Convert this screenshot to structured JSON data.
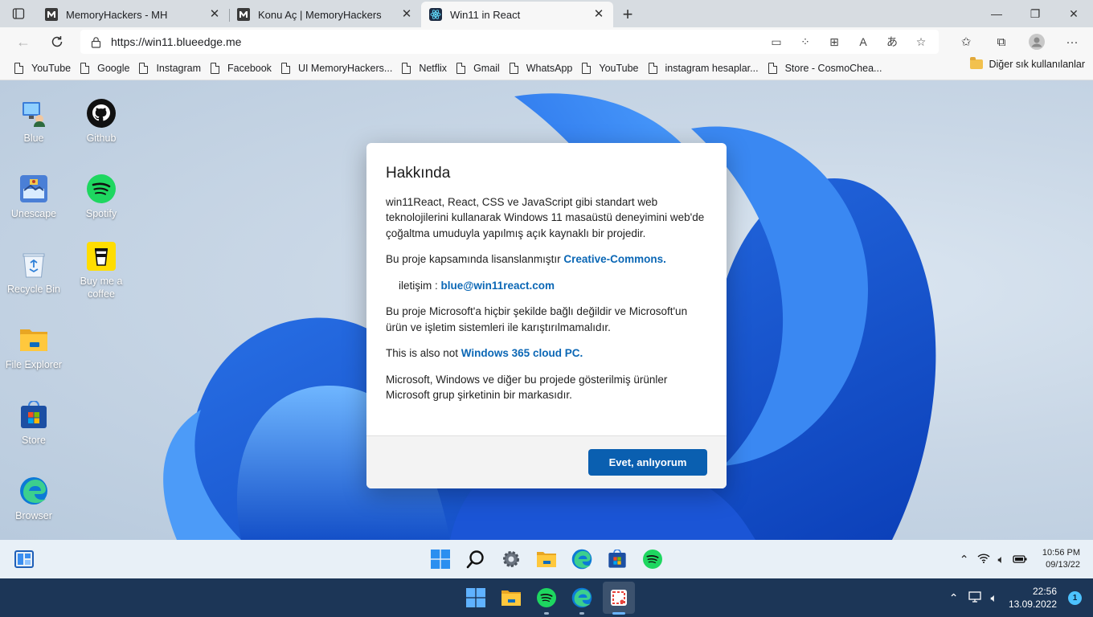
{
  "browser": {
    "tabs": [
      {
        "title": "MemoryHackers - MH",
        "icon": "memoryhackers-favicon",
        "active": false
      },
      {
        "title": "Konu Aç | MemoryHackers",
        "icon": "memoryhackers-favicon",
        "active": false
      },
      {
        "title": "Win11 in React",
        "icon": "react-favicon",
        "active": true
      }
    ],
    "url": "https://win11.blueedge.me",
    "bookmarks": [
      "YouTube",
      "Google",
      "Instagram",
      "Facebook",
      "UI MemoryHackers...",
      "Netflix",
      "Gmail",
      "WhatsApp",
      "YouTube",
      "instagram hesaplar...",
      "Store - CosmoChea..."
    ],
    "other_bookmarks": "Diğer sık kullanılanlar"
  },
  "desktop": {
    "icons": [
      {
        "label": "Blue",
        "icon": "blue-pc-icon"
      },
      {
        "label": "Github",
        "icon": "github-icon"
      },
      {
        "label": "Unescape",
        "icon": "unescape-icon"
      },
      {
        "label": "Spotify",
        "icon": "spotify-icon"
      },
      {
        "label": "Recycle Bin",
        "icon": "recycle-bin-icon"
      },
      {
        "label": "Buy me a coffee",
        "icon": "coffee-icon"
      },
      {
        "label": "File Explorer",
        "icon": "folder-icon"
      },
      {
        "label": "Store",
        "icon": "store-icon"
      },
      {
        "label": "Browser",
        "icon": "edge-icon"
      }
    ]
  },
  "dialog": {
    "title": "Hakkında",
    "p1": "win11React, React, CSS ve JavaScript gibi standart web teknolojilerini kullanarak Windows 11 masaüstü deneyimini web'de çoğaltma umuduyla yapılmış açık kaynaklı bir projedir.",
    "license_text": "Bu proje kapsamında lisanslanmıştır ",
    "license_link": "Creative-Commons.",
    "contact_label": "iletişim : ",
    "contact_email": "blue@win11react.com",
    "p3": "Bu proje Microsoft'a hiçbir şekilde bağlı değildir ve Microsoft'un ürün ve işletim sistemleri ile karıştırılmamalıdır.",
    "p4_text": "This is also not ",
    "p4_link": "Windows 365 cloud PC.",
    "p5": "Microsoft, Windows ve diğer bu projede gösterilmiş ürünler Microsoft grup şirketinin bir markasıdır.",
    "ok_button": "Evet, anlıyorum"
  },
  "react_taskbar": {
    "time": "10:56 PM",
    "date": "09/13/22"
  },
  "host_taskbar": {
    "time": "22:56",
    "date": "13.09.2022",
    "notifications": "1"
  },
  "colors": {
    "accent": "#0a5fb0",
    "link": "#0b67b5",
    "host_taskbar": "#1c3657"
  }
}
